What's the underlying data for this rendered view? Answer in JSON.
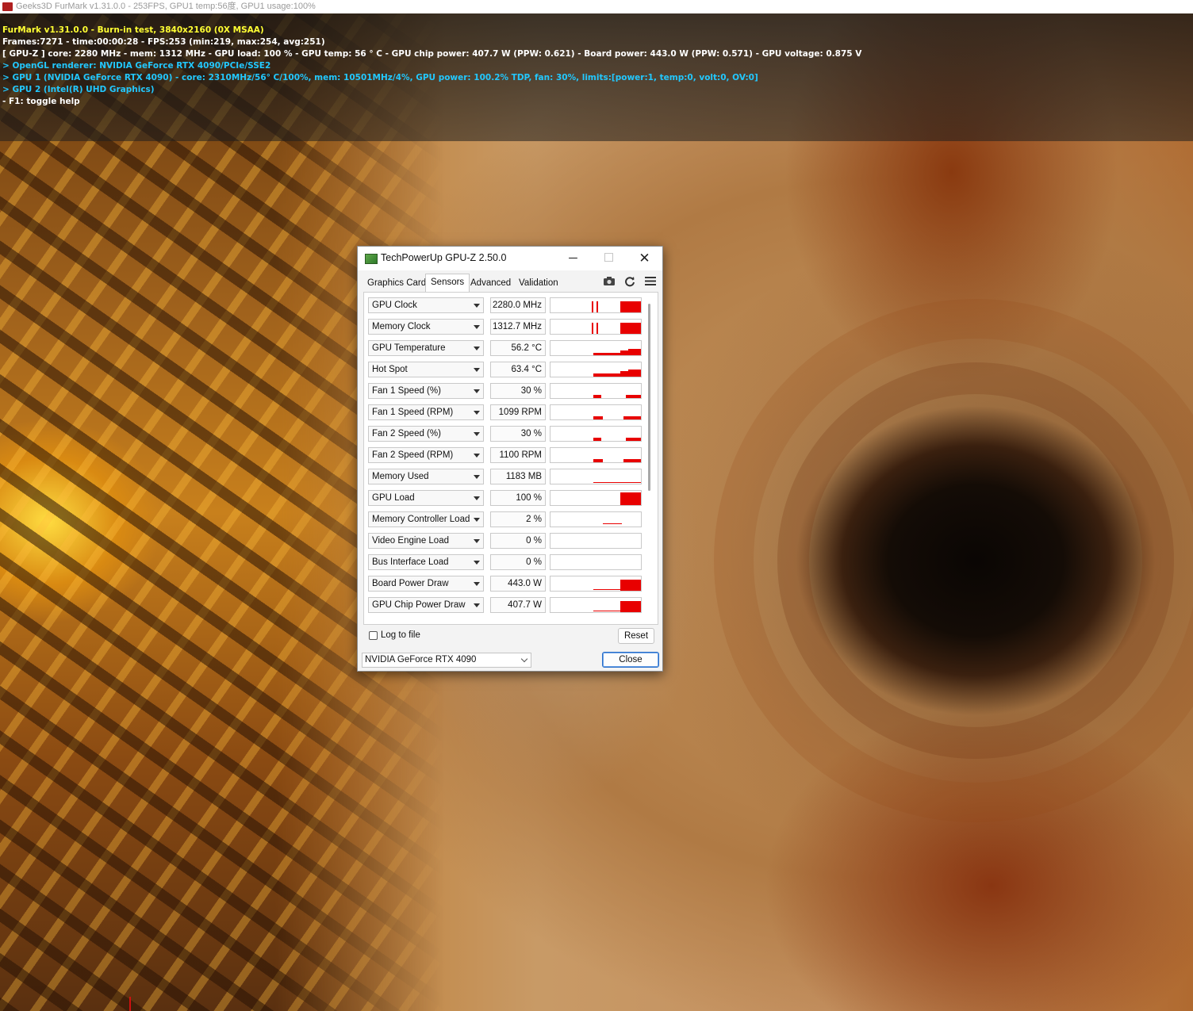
{
  "furmark_window": {
    "title": "Geeks3D FurMark v1.31.0.0 - 253FPS, GPU1 temp:56度, GPU1 usage:100%"
  },
  "osd": {
    "lines": [
      {
        "text": "FurMark v1.31.0.0 - Burn-in test, 3840x2160 (0X MSAA)",
        "color": "#ffff33"
      },
      {
        "text": "Frames:7271 - time:00:00:28 - FPS:253 (min:219, max:254, avg:251)",
        "color": "#ffffff"
      },
      {
        "text": "[ GPU-Z ] core: 2280 MHz - mem: 1312 MHz - GPU load: 100 % - GPU temp: 56 ° C - GPU chip power: 407.7 W (PPW: 0.621) - Board power: 443.0 W (PPW: 0.571) - GPU voltage: 0.875 V",
        "color": "#ffffff"
      },
      {
        "text": "> OpenGL renderer: NVIDIA GeForce RTX 4090/PCIe/SSE2",
        "color": "#22c8ff"
      },
      {
        "text": "> GPU 1 (NVIDIA GeForce RTX 4090) - core: 2310MHz/56° C/100%, mem: 10501MHz/4%, GPU power: 100.2% TDP, fan: 30%, limits:[power:1, temp:0, volt:0, OV:0]",
        "color": "#22c8ff"
      },
      {
        "text": "> GPU 2 (Intel(R) UHD Graphics)",
        "color": "#22c8ff"
      },
      {
        "text": "- F1: toggle help",
        "color": "#ffffff"
      }
    ]
  },
  "gpuz": {
    "title": "TechPowerUp GPU-Z 2.50.0",
    "window_buttons": {
      "minimize": "─",
      "maximize": "☐",
      "close": "✕"
    },
    "tabs": [
      {
        "label": "Graphics Card",
        "active": false
      },
      {
        "label": "Sensors",
        "active": true
      },
      {
        "label": "Advanced",
        "active": false
      },
      {
        "label": "Validation",
        "active": false
      }
    ],
    "toolbar_icons": [
      "camera-icon",
      "refresh-icon",
      "menu-icon"
    ],
    "sensors": [
      {
        "name": "GPU Clock",
        "value": "2280.0 MHz"
      },
      {
        "name": "Memory Clock",
        "value": "1312.7 MHz"
      },
      {
        "name": "GPU Temperature",
        "value": "56.2 °C"
      },
      {
        "name": "Hot Spot",
        "value": "63.4 °C"
      },
      {
        "name": "Fan 1 Speed (%)",
        "value": "30 %"
      },
      {
        "name": "Fan 1 Speed (RPM)",
        "value": "1099 RPM"
      },
      {
        "name": "Fan 2 Speed (%)",
        "value": "30 %"
      },
      {
        "name": "Fan 2 Speed (RPM)",
        "value": "1100 RPM"
      },
      {
        "name": "Memory Used",
        "value": "1183 MB"
      },
      {
        "name": "GPU Load",
        "value": "100 %"
      },
      {
        "name": "Memory Controller Load",
        "value": "2 %"
      },
      {
        "name": "Video Engine Load",
        "value": "0 %"
      },
      {
        "name": "Bus Interface Load",
        "value": "0 %"
      },
      {
        "name": "Board Power Draw",
        "value": "443.0 W"
      },
      {
        "name": "GPU Chip Power Draw",
        "value": "407.7 W"
      }
    ],
    "log_to_file_label": "Log to file",
    "log_to_file_checked": false,
    "reset_label": "Reset",
    "gpu_select_value": "NVIDIA GeForce RTX 4090",
    "close_label": "Close",
    "graph_color": "#e80000"
  }
}
